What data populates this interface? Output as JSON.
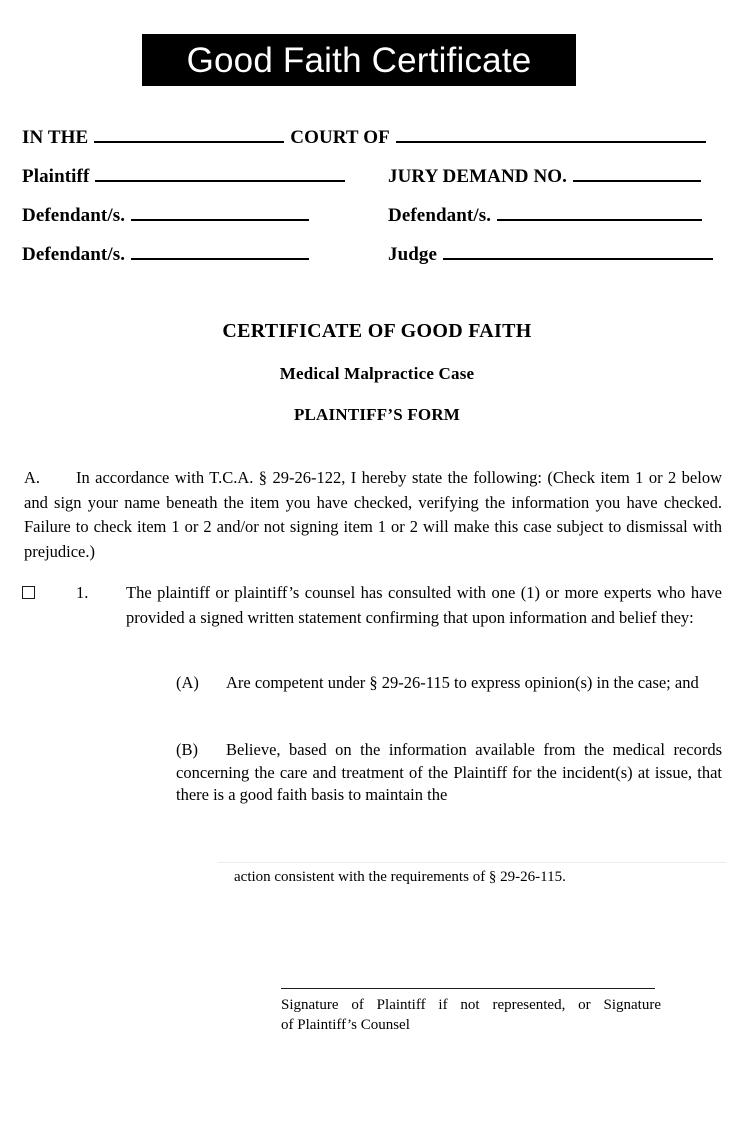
{
  "document": {
    "title_banner": "Good Faith Certificate",
    "caption": {
      "rows": [
        {
          "label_left": "IN THE",
          "label_right": "COURT  OF"
        },
        {
          "label_left": "Plaintiff",
          "label_right": "JURY DEMAND NO."
        },
        {
          "label_left": "Defendant/s.",
          "label_right": "Defendant/s."
        },
        {
          "label_left": "Defendant/s.",
          "label_right": "Judge"
        }
      ]
    },
    "headings": {
      "main": "CERTIFICATE OF GOOD FAITH",
      "sub": "Medical Malpractice Case",
      "third": "PLAINTIFF’S FORM"
    },
    "paragraph_a": {
      "letter": "A.",
      "text": "In accordance with T.C.A. § 29-26-122, I hereby state the following:  (Check item 1 or 2 below and sign your name beneath the item you have checked, verifying the information you have checked.  Failure to check item 1 or 2 and/or not signing item 1 or 2 will make this case subject to dismissal with prejudice.)"
    },
    "item_1": {
      "checkbox_state": "unchecked",
      "number": "1.",
      "text": "The plaintiff or plaintiff’s counsel has consulted with one (1) or more experts who have provided a signed written statement confirming that upon information and belief they:",
      "sub_items": [
        {
          "letter": "(A)",
          "text": "Are competent under § 29-26-115 to express opinion(s) in the case; and"
        },
        {
          "letter": "(B)",
          "text": "Believe, based on the information available from the medical records concerning the care and treatment of the Plaintiff for the incident(s) at issue, that there is a good faith basis to maintain the"
        }
      ]
    },
    "continuation": "action consistent with the requirements of § 29-26-115.",
    "signature": {
      "caption_line_1": "Signature of Plaintiff if not represented, or Signature",
      "caption_line_2": "of Plaintiff’s Counsel"
    }
  }
}
